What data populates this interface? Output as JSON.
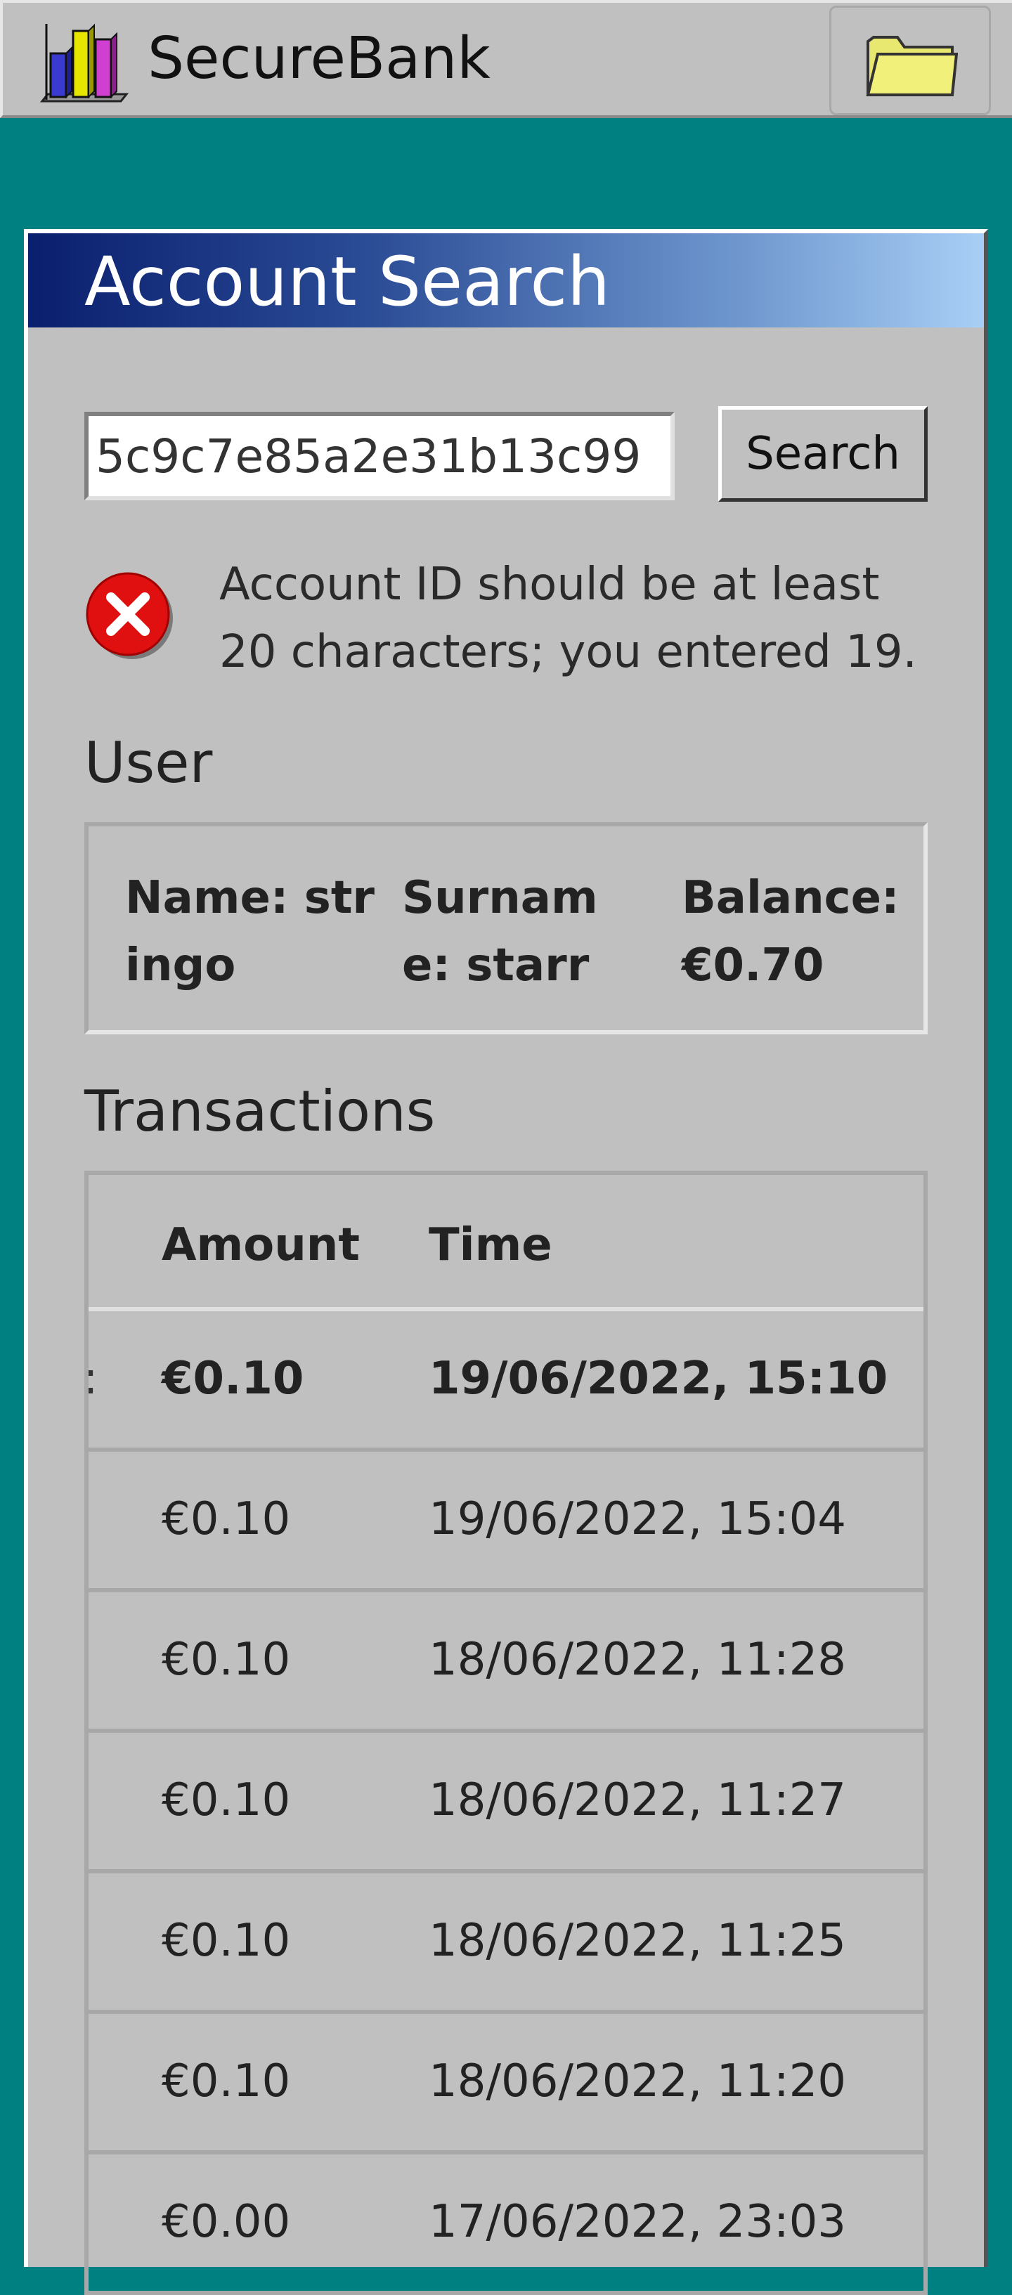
{
  "app": {
    "title": "SecureBank",
    "logo_icon": "bar-chart-icon",
    "folder_icon": "folder-icon"
  },
  "window": {
    "title": "Account Search"
  },
  "search": {
    "value": "5c9c7e85a2e31b13c99",
    "button_label": "Search"
  },
  "error": {
    "icon": "error-icon",
    "message": "Account ID should be at least 20 characters; you entered 19."
  },
  "user": {
    "heading": "User",
    "name": "Name: stringo",
    "surname": "Surname: starr",
    "balance": "Balance: €0.70"
  },
  "transactions": {
    "heading": "Transactions",
    "columns": [
      "Amount",
      "Time"
    ],
    "rows": [
      {
        "amount": "€0.10",
        "time": "19/06/2022, 15:10",
        "selected": true
      },
      {
        "amount": "€0.10",
        "time": "19/06/2022, 15:04"
      },
      {
        "amount": "€0.10",
        "time": "18/06/2022, 11:28"
      },
      {
        "amount": "€0.10",
        "time": "18/06/2022, 11:27"
      },
      {
        "amount": "€0.10",
        "time": "18/06/2022, 11:25"
      },
      {
        "amount": "€0.10",
        "time": "18/06/2022, 11:20"
      },
      {
        "amount": "€0.00",
        "time": "17/06/2022, 23:03"
      }
    ]
  },
  "colors": {
    "desktop": "#008080",
    "chrome": "#c0c0c0",
    "title_gradient_start": "#0a1f6e",
    "title_gradient_end": "#a8cff5",
    "error_red": "#e01010"
  }
}
